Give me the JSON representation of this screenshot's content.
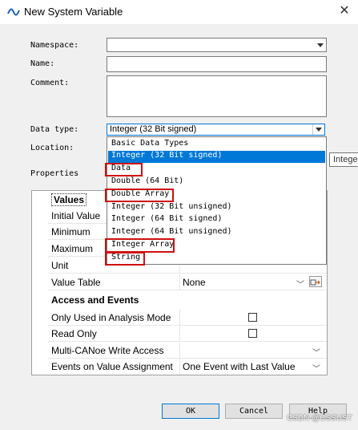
{
  "window": {
    "title": "New System Variable",
    "close_glyph": "✕"
  },
  "form": {
    "namespace_label": "Namespace:",
    "name_label": "Name:",
    "comment_label": "Comment:",
    "datatype_label": "Data type:",
    "datatype_value": "Integer (32 Bit signed)",
    "location_label": "Location:",
    "properties_label": "Properties"
  },
  "dropdown": {
    "header": "Basic Data Types",
    "options": [
      "Integer (32 Bit signed)",
      "Data",
      "Double (64 Bit)",
      "Double Array",
      "Integer (32 Bit unsigned)",
      "Integer (64 Bit signed)",
      "Integer (64 Bit unsigned)",
      "Integer Array",
      "String"
    ],
    "selected_index": 0,
    "highlighted": [
      "Data",
      "Double Array",
      "Integer Array",
      "String"
    ],
    "highlight_color": "#d01010"
  },
  "tooltip": {
    "text": "Intege"
  },
  "properties": {
    "values_group": "Values",
    "rows": [
      {
        "key": "Initial Value",
        "value": ""
      },
      {
        "key": "Minimum",
        "value": ""
      },
      {
        "key": "Maximum",
        "value": ""
      },
      {
        "key": "Unit",
        "value": ""
      },
      {
        "key": "Value Table",
        "value": "None"
      }
    ],
    "access_group": "Access and Events",
    "access_rows": [
      {
        "key": "Only Used in Analysis Mode",
        "value": "",
        "checked": false
      },
      {
        "key": "Read Only",
        "value": "",
        "checked": false
      },
      {
        "key": "Multi-CANoe Write Access",
        "value": ""
      },
      {
        "key": "Events on Value Assignment",
        "value": "One Event with Last Value"
      }
    ]
  },
  "buttons": {
    "ok": "OK",
    "cancel": "Cancel",
    "help": "Help"
  },
  "watermark": "CSDN @CSSUST",
  "colors": {
    "accent": "#0078d7",
    "window_bg": "#f0f0f0"
  }
}
